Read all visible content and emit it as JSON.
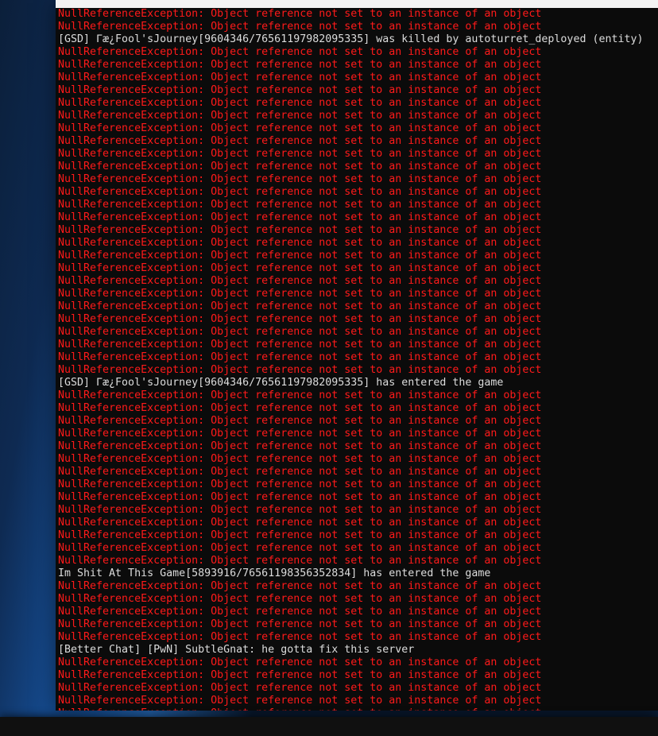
{
  "console": {
    "colors": {
      "error": "#ff1a1a",
      "info": "#dcdcdc",
      "bg": "#0b0b0b"
    },
    "error_text": "NullReferenceException: Object reference not set to an instance of an object",
    "lines": [
      {
        "type": "err",
        "text": "NullReferenceException: Object reference not set to an instance of an object"
      },
      {
        "type": "err",
        "text": "NullReferenceException: Object reference not set to an instance of an object"
      },
      {
        "type": "info",
        "text": "[GSD] Γæ¿Fool'sJourney[9604346/76561197982095335] was killed by autoturret_deployed (entity)"
      },
      {
        "type": "err",
        "text": "NullReferenceException: Object reference not set to an instance of an object"
      },
      {
        "type": "err",
        "text": "NullReferenceException: Object reference not set to an instance of an object"
      },
      {
        "type": "err",
        "text": "NullReferenceException: Object reference not set to an instance of an object"
      },
      {
        "type": "err",
        "text": "NullReferenceException: Object reference not set to an instance of an object"
      },
      {
        "type": "err",
        "text": "NullReferenceException: Object reference not set to an instance of an object"
      },
      {
        "type": "err",
        "text": "NullReferenceException: Object reference not set to an instance of an object"
      },
      {
        "type": "err",
        "text": "NullReferenceException: Object reference not set to an instance of an object"
      },
      {
        "type": "err",
        "text": "NullReferenceException: Object reference not set to an instance of an object"
      },
      {
        "type": "err",
        "text": "NullReferenceException: Object reference not set to an instance of an object"
      },
      {
        "type": "err",
        "text": "NullReferenceException: Object reference not set to an instance of an object"
      },
      {
        "type": "err",
        "text": "NullReferenceException: Object reference not set to an instance of an object"
      },
      {
        "type": "err",
        "text": "NullReferenceException: Object reference not set to an instance of an object"
      },
      {
        "type": "err",
        "text": "NullReferenceException: Object reference not set to an instance of an object"
      },
      {
        "type": "err",
        "text": "NullReferenceException: Object reference not set to an instance of an object"
      },
      {
        "type": "err",
        "text": "NullReferenceException: Object reference not set to an instance of an object"
      },
      {
        "type": "err",
        "text": "NullReferenceException: Object reference not set to an instance of an object"
      },
      {
        "type": "err",
        "text": "NullReferenceException: Object reference not set to an instance of an object"
      },
      {
        "type": "err",
        "text": "NullReferenceException: Object reference not set to an instance of an object"
      },
      {
        "type": "err",
        "text": "NullReferenceException: Object reference not set to an instance of an object"
      },
      {
        "type": "err",
        "text": "NullReferenceException: Object reference not set to an instance of an object"
      },
      {
        "type": "err",
        "text": "NullReferenceException: Object reference not set to an instance of an object"
      },
      {
        "type": "err",
        "text": "NullReferenceException: Object reference not set to an instance of an object"
      },
      {
        "type": "err",
        "text": "NullReferenceException: Object reference not set to an instance of an object"
      },
      {
        "type": "err",
        "text": "NullReferenceException: Object reference not set to an instance of an object"
      },
      {
        "type": "err",
        "text": "NullReferenceException: Object reference not set to an instance of an object"
      },
      {
        "type": "err",
        "text": "NullReferenceException: Object reference not set to an instance of an object"
      },
      {
        "type": "info",
        "text": "[GSD] Γæ¿Fool'sJourney[9604346/76561197982095335] has entered the game"
      },
      {
        "type": "err",
        "text": "NullReferenceException: Object reference not set to an instance of an object"
      },
      {
        "type": "err",
        "text": "NullReferenceException: Object reference not set to an instance of an object"
      },
      {
        "type": "err",
        "text": "NullReferenceException: Object reference not set to an instance of an object"
      },
      {
        "type": "err",
        "text": "NullReferenceException: Object reference not set to an instance of an object"
      },
      {
        "type": "err",
        "text": "NullReferenceException: Object reference not set to an instance of an object"
      },
      {
        "type": "err",
        "text": "NullReferenceException: Object reference not set to an instance of an object"
      },
      {
        "type": "err",
        "text": "NullReferenceException: Object reference not set to an instance of an object"
      },
      {
        "type": "err",
        "text": "NullReferenceException: Object reference not set to an instance of an object"
      },
      {
        "type": "err",
        "text": "NullReferenceException: Object reference not set to an instance of an object"
      },
      {
        "type": "err",
        "text": "NullReferenceException: Object reference not set to an instance of an object"
      },
      {
        "type": "err",
        "text": "NullReferenceException: Object reference not set to an instance of an object"
      },
      {
        "type": "err",
        "text": "NullReferenceException: Object reference not set to an instance of an object"
      },
      {
        "type": "err",
        "text": "NullReferenceException: Object reference not set to an instance of an object"
      },
      {
        "type": "err",
        "text": "NullReferenceException: Object reference not set to an instance of an object"
      },
      {
        "type": "info",
        "text": "Im Shit At This Game[5893916/76561198356352834] has entered the game"
      },
      {
        "type": "err",
        "text": "NullReferenceException: Object reference not set to an instance of an object"
      },
      {
        "type": "err",
        "text": "NullReferenceException: Object reference not set to an instance of an object"
      },
      {
        "type": "err",
        "text": "NullReferenceException: Object reference not set to an instance of an object"
      },
      {
        "type": "err",
        "text": "NullReferenceException: Object reference not set to an instance of an object"
      },
      {
        "type": "err",
        "text": "NullReferenceException: Object reference not set to an instance of an object"
      },
      {
        "type": "info",
        "text": "[Better Chat] [PwN] SubtleGnat: he gotta fix this server"
      },
      {
        "type": "err",
        "text": "NullReferenceException: Object reference not set to an instance of an object"
      },
      {
        "type": "err",
        "text": "NullReferenceException: Object reference not set to an instance of an object"
      },
      {
        "type": "err",
        "text": "NullReferenceException: Object reference not set to an instance of an object"
      },
      {
        "type": "err",
        "text": "NullReferenceException: Object reference not set to an instance of an object"
      },
      {
        "type": "err",
        "text": "NullReferenceException: Object reference not set to an instance of an object"
      }
    ]
  }
}
